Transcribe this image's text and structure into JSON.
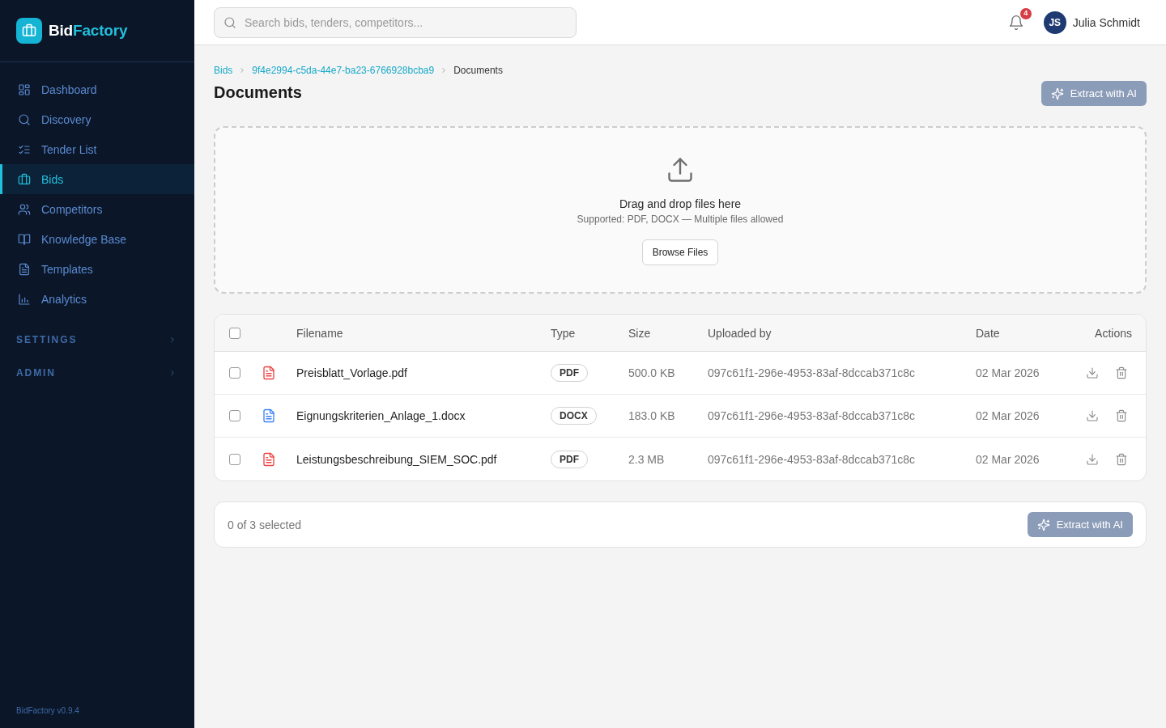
{
  "sidebar": {
    "logo": {
      "name_start": "Bid",
      "name_end": "Factory"
    },
    "items": [
      {
        "label": "Dashboard",
        "selected": false
      },
      {
        "label": "Discovery",
        "selected": false
      },
      {
        "label": "Tender List",
        "selected": false
      },
      {
        "label": "Bids",
        "selected": true
      },
      {
        "label": "Competitors",
        "selected": false
      },
      {
        "label": "Knowledge Base",
        "selected": false
      },
      {
        "label": "Templates",
        "selected": false
      },
      {
        "label": "Analytics",
        "selected": false
      }
    ],
    "sections": [
      {
        "label": "SETTINGS",
        "expanded": false
      },
      {
        "label": "ADMIN",
        "expanded": false
      }
    ],
    "version": "BidFactory v0.9.4"
  },
  "top_bar": {
    "search": {
      "placeholder": "Search bids, tenders, competitors..."
    },
    "notifications": {
      "count": "4"
    },
    "user": {
      "initials": "JS",
      "name": "Julia Schmidt"
    }
  },
  "breadcrumb": [
    {
      "label": "Bids",
      "current": false
    },
    {
      "label": "9f4e2994-c5da-44e7-ba23-6766928bcba9",
      "current": false
    },
    {
      "label": "Documents",
      "current": true
    }
  ],
  "page_title": "Documents",
  "extract_button": {
    "label": "Extract with AI",
    "disabled": true
  },
  "dropzone": {
    "title": "Drag and drop files here",
    "hint": "Supported: PDF, DOCX — Multiple files allowed",
    "button": "Browse Files"
  },
  "table": {
    "select_all": {
      "checked": false
    },
    "columns": [
      "Filename",
      "Type",
      "Size",
      "Uploaded by",
      "Date",
      "Actions"
    ],
    "rows": [
      {
        "checked": false,
        "color": "#ef4444",
        "filename": "Preisblatt_Vorlage.pdf",
        "type": "PDF",
        "size": "500.0 KB",
        "uploaded_by": "097c61f1-296e-4953-83af-8dccab371c8c",
        "date": "02 Mar 2026"
      },
      {
        "checked": false,
        "color": "#3b82f6",
        "filename": "Eignungskriterien_Anlage_1.docx",
        "type": "DOCX",
        "size": "183.0 KB",
        "uploaded_by": "097c61f1-296e-4953-83af-8dccab371c8c",
        "date": "02 Mar 2026"
      },
      {
        "checked": false,
        "color": "#ef4444",
        "filename": "Leistungsbeschreibung_SIEM_SOC.pdf",
        "type": "PDF",
        "size": "2.3 MB",
        "uploaded_by": "097c61f1-296e-4953-83af-8dccab371c8c",
        "date": "02 Mar 2026"
      }
    ]
  },
  "selection_bar": {
    "summary": "0 of 3 selected",
    "button": {
      "label": "Extract with AI",
      "disabled": true
    }
  }
}
